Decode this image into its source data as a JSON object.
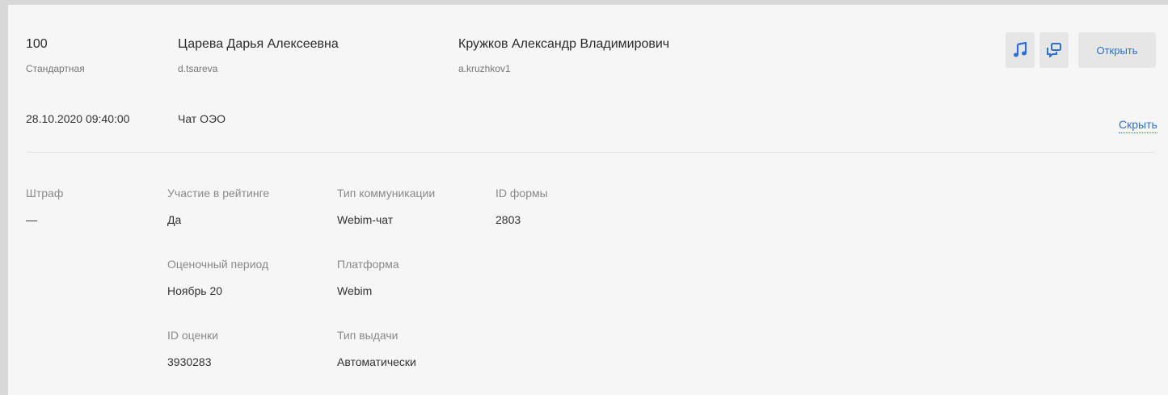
{
  "record": {
    "score": "100",
    "type": "Стандартная",
    "date": "28.10.2020 09:40:00",
    "channel": "Чат ОЭО"
  },
  "employee": {
    "name": "Царева Дарья Алексеевна",
    "login": "d.tsareva"
  },
  "evaluator": {
    "name": "Кружков Александр Владимирович",
    "login": "a.kruzhkov1"
  },
  "actions": {
    "audio_icon": "music-note-icon",
    "chat_icon": "chat-bubbles-icon",
    "open_label": "Открыть",
    "hide_label": "Скрыть",
    "accent_color": "#2e6fd1"
  },
  "details": {
    "penalty": {
      "label": "Штраф",
      "value": "—"
    },
    "rating_participation": {
      "label": "Участие в рейтинге",
      "value": "Да"
    },
    "evaluation_period": {
      "label": "Оценочный период",
      "value": "Ноябрь 20"
    },
    "evaluation_id": {
      "label": "ID оценки",
      "value": "3930283"
    },
    "communication_type": {
      "label": "Тип коммуникации",
      "value": "Webim-чат"
    },
    "platform": {
      "label": "Платформа",
      "value": "Webim"
    },
    "issue_type": {
      "label": "Тип выдачи",
      "value": "Автоматически"
    },
    "form_id": {
      "label": "ID формы",
      "value": "2803"
    }
  }
}
